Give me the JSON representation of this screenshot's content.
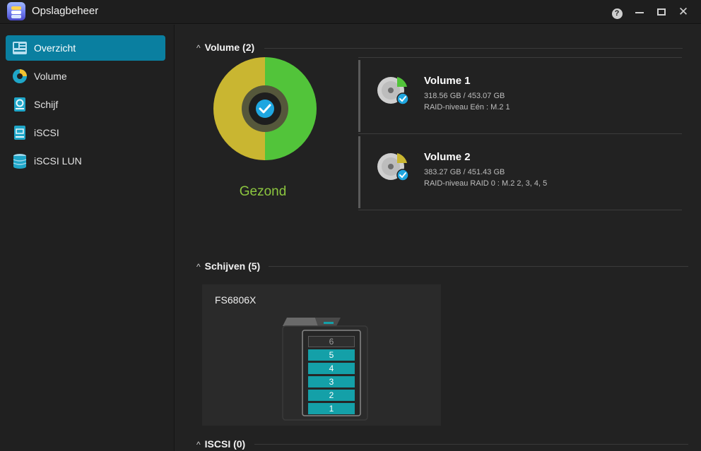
{
  "app": {
    "title": "Opslagbeheer"
  },
  "window": {
    "help_glyph": "?",
    "close_glyph": "✕"
  },
  "sidebar": {
    "items": [
      {
        "label": "Overzicht",
        "icon": "overview-icon",
        "active": true
      },
      {
        "label": "Volume",
        "icon": "volume-icon",
        "active": false
      },
      {
        "label": "Schijf",
        "icon": "disk-icon",
        "active": false
      },
      {
        "label": "iSCSI",
        "icon": "iscsi-icon",
        "active": false
      },
      {
        "label": "iSCSI LUN",
        "icon": "iscsi-lun-icon",
        "active": false
      }
    ]
  },
  "volume_section": {
    "heading": "Volume (2)",
    "status": "Gezond",
    "status_color": "#8cc63f",
    "chart_colors": {
      "left": "#c9b631",
      "right": "#52c43a"
    },
    "volumes": [
      {
        "name": "Volume 1",
        "size": "318.56 GB / 453.07 GB",
        "raid": "RAID-niveau Eén : M.2 1",
        "usage_color": "#52c43a"
      },
      {
        "name": "Volume 2",
        "size": "383.27 GB / 451.43 GB",
        "raid": "RAID-niveau RAID 0 : M.2 2, 3, 4, 5",
        "usage_color": "#c9b631"
      }
    ]
  },
  "disks_section": {
    "heading": "Schijven (5)",
    "device": {
      "name": "FS6806X",
      "bays": [
        {
          "label": "6",
          "filled": false
        },
        {
          "label": "5",
          "filled": true
        },
        {
          "label": "4",
          "filled": true
        },
        {
          "label": "3",
          "filled": true
        },
        {
          "label": "2",
          "filled": true
        },
        {
          "label": "1",
          "filled": true
        }
      ]
    }
  },
  "iscsi_section": {
    "heading": "ISCSI (0)"
  }
}
